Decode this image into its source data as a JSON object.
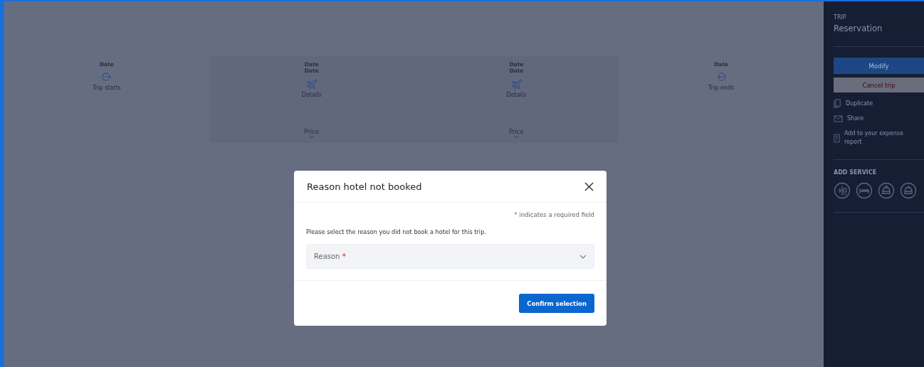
{
  "timeline": [
    {
      "kind": "start",
      "dates": [
        "Date"
      ],
      "label": "Trip starts"
    },
    {
      "kind": "flight",
      "dates": [
        "Date",
        "Date"
      ],
      "label": "Details",
      "price": "Price"
    },
    {
      "kind": "flight",
      "dates": [
        "Date",
        "Date"
      ],
      "label": "Details",
      "price": "Price"
    },
    {
      "kind": "end",
      "dates": [
        "Date"
      ],
      "label": "Trip ends"
    }
  ],
  "sidebar": {
    "eyebrow": "TRIP",
    "title": "Reservation",
    "primary_button": "Modify",
    "danger_button": "Cancel trip",
    "actions": [
      {
        "kind": "duplicate",
        "label": "Duplicate"
      },
      {
        "kind": "share",
        "label": "Share"
      },
      {
        "kind": "expense",
        "label": "Add to your expense report"
      }
    ],
    "add_service": {
      "heading": "ADD SERVICE",
      "services": [
        {
          "kind": "flight-train"
        },
        {
          "kind": "hotel"
        },
        {
          "kind": "car"
        },
        {
          "kind": "taxi"
        }
      ]
    }
  },
  "modal": {
    "title": "Reason hotel not booked",
    "required_note": "* indicates a required field",
    "prompt": "Please select the reason you did not book a hotel for this trip.",
    "select": {
      "placeholder": "Reason",
      "required_mark": "*"
    },
    "confirm_button": "Confirm selection"
  }
}
